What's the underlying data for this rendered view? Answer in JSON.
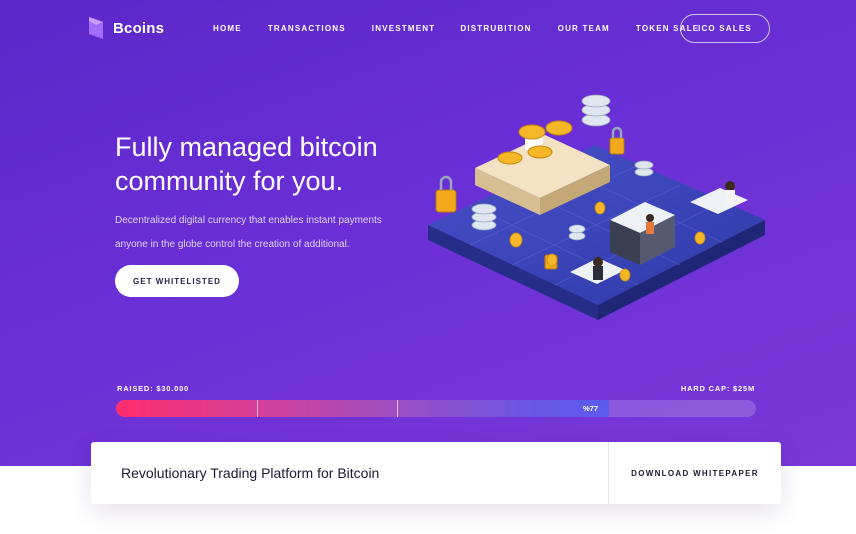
{
  "brand": {
    "name": "Bcoins",
    "accent": "#6a2fd6",
    "cta_pink": "#ff2d6e"
  },
  "nav": {
    "items": [
      "HOME",
      "TRANSACTIONS",
      "INVESTMENT",
      "DISTRUBITION",
      "OUR TEAM",
      "TOKEN SALE"
    ],
    "cta": "ICO SALES"
  },
  "hero": {
    "headline": "Fully managed bitcoin community for you.",
    "subtext": "Decentralized digital currency that enables instant payments anyone in the globe control the creation of additional.",
    "button": "GET WHITELISTED",
    "illustration": "isometric-crypto-platform"
  },
  "progress": {
    "raised_label": "RAISED: $30.000",
    "hardcap_label": "HARD CAP: $25M",
    "percent_label": "%77",
    "fill_fraction": 0.77
  },
  "card": {
    "title": "Revolutionary Trading Platform for Bitcoin",
    "link": "DOWNLOAD WHITEPAPER"
  }
}
